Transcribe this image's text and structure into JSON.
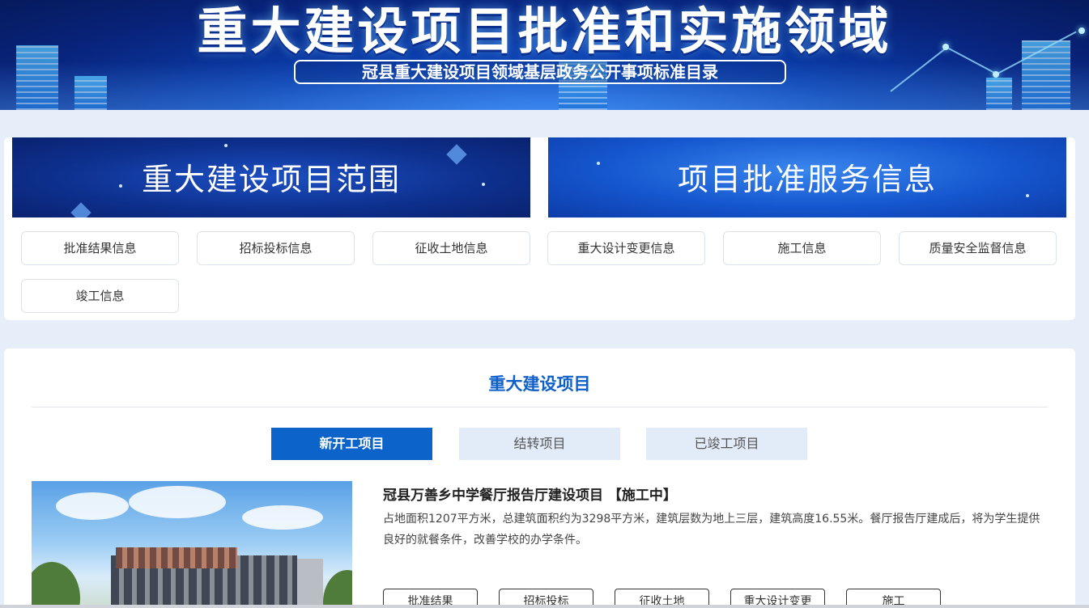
{
  "header": {
    "title": "重大建设项目批准和实施领域",
    "subtitle": "冠县重大建设项目领域基层政务公开事项标准目录"
  },
  "categories": {
    "banners": [
      "重大建设项目范围",
      "项目批准服务信息"
    ],
    "buttons": [
      "批准结果信息",
      "招标投标信息",
      "征收土地信息",
      "重大设计变更信息",
      "施工信息",
      "质量安全监督信息",
      "竣工信息"
    ]
  },
  "projects": {
    "section_title": "重大建设项目",
    "tabs": [
      "新开工项目",
      "结转项目",
      "已竣工项目"
    ],
    "active_tab": "新开工项目",
    "item": {
      "title": "冠县万善乡中学餐厅报告厅建设项目  【施工中】",
      "description": "占地面积1207平方米，总建筑面积约为3298平方米，建筑层数为地上三层，建筑高度16.55米。餐厅报告厅建成后，将为学生提供良好的就餐条件，改善学校的办学条件。",
      "buttons": [
        "批准结果",
        "招标投标",
        "征收土地",
        "重大设计变更",
        "施工"
      ]
    }
  },
  "colors": {
    "accent": "#0c63c9",
    "page_bg": "#e6eef9",
    "tab_inactive": "#e2ecf8"
  }
}
